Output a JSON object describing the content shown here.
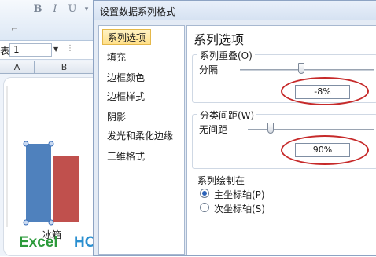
{
  "excel": {
    "ribbon": {
      "bold": "B",
      "italic": "I",
      "underline": "U",
      "dropdown": "▾"
    },
    "namebox": {
      "label": "表",
      "value": "1"
    },
    "columns": [
      "A",
      "B"
    ],
    "chart": {
      "category": "冰箱",
      "series_colors": [
        "#4f81bd",
        "#c0504d"
      ]
    },
    "logo": {
      "part1": "Excel",
      "part2": "HOME"
    }
  },
  "dialog": {
    "title": "设置数据系列格式",
    "nav_items": [
      "系列选项",
      "填充",
      "边框颜色",
      "边框样式",
      "阴影",
      "发光和柔化边缘",
      "三维格式"
    ],
    "selected_nav": "系列选项",
    "pane_title": "系列选项",
    "overlap": {
      "group_label": "系列重叠(O)",
      "min_label": "分隔",
      "value": "-8%",
      "slider_level": 0.46
    },
    "gap": {
      "group_label": "分类间距(W)",
      "min_label": "无间距",
      "value": "90%",
      "slider_level": 0.18
    },
    "plot_on": {
      "group_label": "系列绘制在",
      "options": [
        "主坐标轴(P)",
        "次坐标轴(S)"
      ],
      "selected": "主坐标轴(P)"
    },
    "highlight_color": "#c62a2a"
  }
}
